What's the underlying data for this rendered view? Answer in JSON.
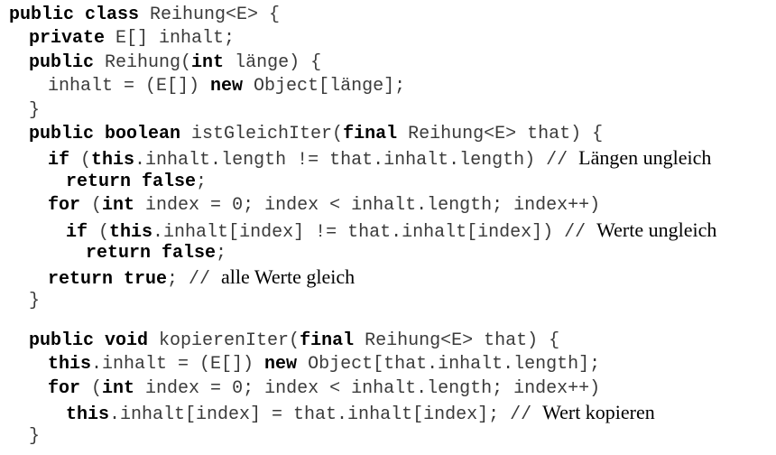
{
  "code_lines": [
    {
      "indent": 0,
      "tokens": [
        {
          "t": "kw",
          "v": "public class"
        },
        {
          "t": "tx",
          "v": " Reihung<E> {"
        }
      ]
    },
    {
      "indent": 1,
      "tokens": [
        {
          "t": "kw",
          "v": "private"
        },
        {
          "t": "tx",
          "v": " E[] inhalt;"
        }
      ]
    },
    {
      "indent": 1,
      "tokens": [
        {
          "t": "kw",
          "v": "public"
        },
        {
          "t": "tx",
          "v": " Reihung("
        },
        {
          "t": "kw",
          "v": "int"
        },
        {
          "t": "tx",
          "v": " länge) {"
        }
      ]
    },
    {
      "indent": 2,
      "tokens": [
        {
          "t": "tx",
          "v": "inhalt = (E[]) "
        },
        {
          "t": "kw",
          "v": "new"
        },
        {
          "t": "tx",
          "v": " Object[länge];"
        }
      ]
    },
    {
      "indent": 1,
      "tokens": [
        {
          "t": "tx",
          "v": "}"
        }
      ]
    },
    {
      "indent": 1,
      "tokens": [
        {
          "t": "kw",
          "v": "public boolean"
        },
        {
          "t": "tx",
          "v": " istGleichIter("
        },
        {
          "t": "kw",
          "v": "final"
        },
        {
          "t": "tx",
          "v": " Reihung<E> that) {"
        }
      ]
    },
    {
      "indent": 2,
      "tokens": [
        {
          "t": "kw",
          "v": "if"
        },
        {
          "t": "tx",
          "v": " ("
        },
        {
          "t": "kw",
          "v": "this"
        },
        {
          "t": "tx",
          "v": ".inhalt.length != that.inhalt.length) // "
        },
        {
          "t": "cm",
          "v": "Längen ungleich"
        }
      ]
    },
    {
      "indent": 3,
      "tokens": [
        {
          "t": "kw",
          "v": "return false"
        },
        {
          "t": "tx",
          "v": ";"
        }
      ]
    },
    {
      "indent": 2,
      "tokens": [
        {
          "t": "kw",
          "v": "for"
        },
        {
          "t": "tx",
          "v": " ("
        },
        {
          "t": "kw",
          "v": "int"
        },
        {
          "t": "tx",
          "v": " index = 0; index < inhalt.length; index++)"
        }
      ]
    },
    {
      "indent": 3,
      "tokens": [
        {
          "t": "kw",
          "v": "if"
        },
        {
          "t": "tx",
          "v": " ("
        },
        {
          "t": "kw",
          "v": "this"
        },
        {
          "t": "tx",
          "v": ".inhalt[index] != that.inhalt[index]) // "
        },
        {
          "t": "cm",
          "v": "Werte ungleich"
        }
      ]
    },
    {
      "indent": 4,
      "tokens": [
        {
          "t": "kw",
          "v": "return false"
        },
        {
          "t": "tx",
          "v": ";"
        }
      ]
    },
    {
      "indent": 2,
      "tokens": [
        {
          "t": "kw",
          "v": "return true"
        },
        {
          "t": "tx",
          "v": "; // "
        },
        {
          "t": "cm",
          "v": "alle Werte gleich"
        }
      ]
    },
    {
      "indent": 1,
      "tokens": [
        {
          "t": "tx",
          "v": "}"
        }
      ]
    },
    {
      "blank": true
    },
    {
      "indent": 1,
      "tokens": [
        {
          "t": "kw",
          "v": "public void"
        },
        {
          "t": "tx",
          "v": " kopierenIter("
        },
        {
          "t": "kw",
          "v": "final"
        },
        {
          "t": "tx",
          "v": " Reihung<E> that) {"
        }
      ]
    },
    {
      "indent": 2,
      "tokens": [
        {
          "t": "kw",
          "v": "this"
        },
        {
          "t": "tx",
          "v": ".inhalt = (E[]) "
        },
        {
          "t": "kw",
          "v": "new"
        },
        {
          "t": "tx",
          "v": " Object[that.inhalt.length];"
        }
      ]
    },
    {
      "indent": 2,
      "tokens": [
        {
          "t": "kw",
          "v": "for"
        },
        {
          "t": "tx",
          "v": " ("
        },
        {
          "t": "kw",
          "v": "int"
        },
        {
          "t": "tx",
          "v": " index = 0; index < inhalt.length; index++)"
        }
      ]
    },
    {
      "indent": 3,
      "tokens": [
        {
          "t": "kw",
          "v": "this"
        },
        {
          "t": "tx",
          "v": ".inhalt[index] = that.inhalt[index]; // "
        },
        {
          "t": "cm",
          "v": "Wert kopieren"
        }
      ]
    },
    {
      "indent": 1,
      "tokens": [
        {
          "t": "tx",
          "v": "}"
        }
      ]
    }
  ]
}
